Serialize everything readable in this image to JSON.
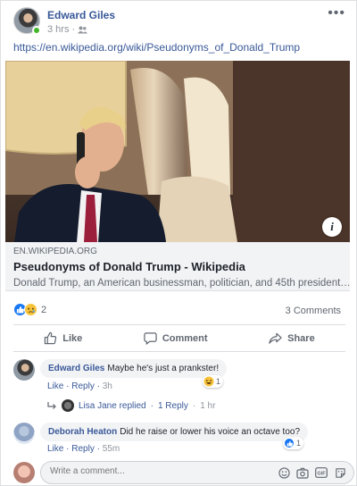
{
  "post": {
    "author": "Edward Giles",
    "time": "3 hrs",
    "audience_icon": "friends-icon",
    "link_url": "https://en.wikipedia.org/wiki/Pseudonyms_of_Donald_Trump",
    "link_domain": "EN.WIKIPEDIA.ORG",
    "link_title": "Pseudonyms of Donald Trump - Wikipedia",
    "link_description": "Donald Trump, an American businessman, politician, and 45th president…",
    "reaction_count": "2",
    "comments_count": "3 Comments"
  },
  "actions": {
    "like": "Like",
    "comment": "Comment",
    "share": "Share"
  },
  "comments": [
    {
      "author": "Edward Giles",
      "text": "Maybe he's just a prankster!",
      "like_label": "Like",
      "reply_label": "Reply",
      "time": "3h",
      "reaction": "haha",
      "reaction_count": "1"
    },
    {
      "author": "Deborah Heaton",
      "text": "Did he raise or lower his voice an octave too?",
      "like_label": "Like",
      "reply_label": "Reply",
      "time": "55m",
      "reaction": "like",
      "reaction_count": "1"
    }
  ],
  "reply_summary": {
    "text": "Lisa Jane replied",
    "count": "1 Reply",
    "time": "1 hr"
  },
  "composer": {
    "placeholder": "Write a comment..."
  },
  "colors": {
    "link": "#385898",
    "like_blue": "#1877f2",
    "online": "#42b72a"
  }
}
